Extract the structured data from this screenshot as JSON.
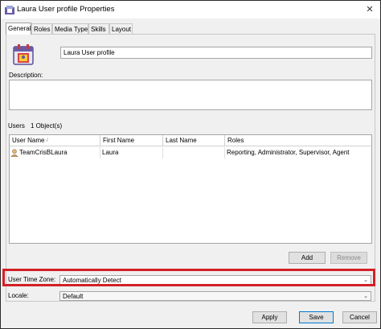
{
  "window": {
    "title": "Laura User profile Properties",
    "close_glyph": "✕"
  },
  "tabs": [
    {
      "label": "General",
      "active": true
    },
    {
      "label": "Roles"
    },
    {
      "label": "Media Type"
    },
    {
      "label": "Skills"
    },
    {
      "label": "Layout"
    }
  ],
  "general": {
    "name_value": "Laura User profile",
    "description_label": "Description:",
    "description_value": ""
  },
  "users": {
    "label": "Users",
    "count": "1 Object(s)",
    "columns": [
      "User Name",
      "First Name",
      "Last Name",
      "Roles"
    ],
    "sort_indicator": "/",
    "rows": [
      {
        "user_name": "TeamCrisBLaura",
        "first_name": "Laura",
        "last_name": "",
        "roles": "Reporting, Administrator, Supervisor, Agent"
      }
    ],
    "add_label": "Add",
    "remove_label": "Remove"
  },
  "time_zone": {
    "label": "User Time Zone:",
    "value": "Automatically Detect"
  },
  "locale": {
    "label": "Locale:",
    "value": "Default"
  },
  "footer": {
    "apply_label": "Apply",
    "save_label": "Save",
    "cancel_label": "Cancel"
  },
  "colors": {
    "highlight": "#d42027",
    "default_button_border": "#0078d7"
  }
}
